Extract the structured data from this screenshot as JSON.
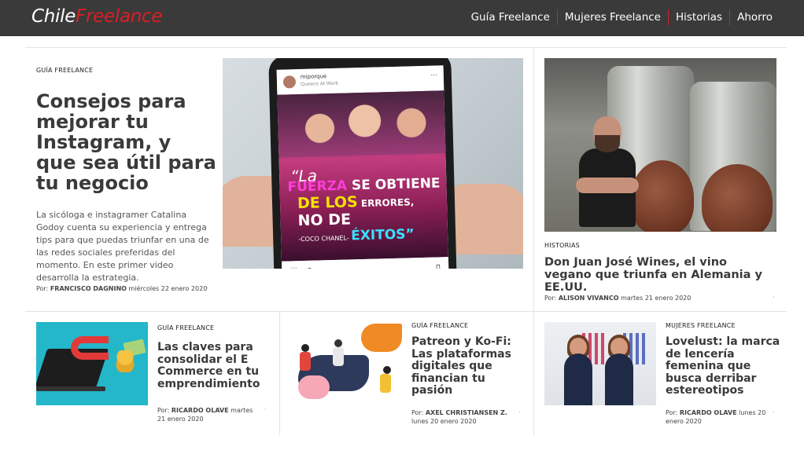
{
  "header": {
    "logo_part1": "Chile",
    "logo_part2": "Freelance",
    "nav": [
      "Guía Freelance",
      "Mujeres Freelance",
      "Historias",
      "Ahorro"
    ]
  },
  "featured": {
    "category": "GUÍA FREELANCE",
    "title": "Consejos para mejorar tu Instagram, y que sea útil para tu negocio",
    "description": "La sicóloga e instagramer Catalina Godoy cuenta su experiencia y entrega tips para que puedas triunfar en una de las redes sociales preferidas del momento. En este primer video desarrolla la estrategia.",
    "meta_prefix": "Por:",
    "author": "FRANCISCO DAGNINO",
    "date": "miércoles 22 enero 2020",
    "image": {
      "ig_user": "miporque",
      "ig_sub": "Queens At Work",
      "quote_mark": "“La",
      "quote_l1a": "FUERZA",
      "quote_l1b": " SE OBTIENE",
      "quote_l2a": "DE LOS",
      "quote_l2b": " ERRORES,",
      "quote_l3": "NO DE",
      "quote_l4a": "-COCO CHANEL- ",
      "quote_l4b": "ÉXITOS”"
    }
  },
  "side_article": {
    "category": "HISTORIAS",
    "title": "Don Juan José Wines, el vino vegano que triunfa en Alemania y EE.UU.",
    "meta_prefix": "Por:",
    "author": "ALISON VIVANCO",
    "date": "martes 21 enero 2020"
  },
  "cards": [
    {
      "category": "GUÍA FREELANCE",
      "title": "Las claves para consolidar el E Commerce en tu emprendimiento",
      "meta_prefix": "Por:",
      "author": "RICARDO OLAVE",
      "date": "martes 21 enero 2020"
    },
    {
      "category": "GUÍA FREELANCE",
      "title": "Patreon y Ko-Fi: Las plataformas digitales que financian tu pasión",
      "meta_prefix": "Por:",
      "author": "AXEL CHRISTIANSEN Z.",
      "date": "lunes 20 enero 2020"
    },
    {
      "category": "MUJERES FREELANCE",
      "title": "Lovelust: la marca de lencería femenina que busca derribar estereotipos",
      "meta_prefix": "Por:",
      "author": "RICARDO OLAVE",
      "date": "lunes 20 enero 2020"
    }
  ],
  "separator": "·",
  "colors": {
    "header_bg": "#3a3a3a",
    "accent": "#d81f26",
    "title": "#3a3a3a"
  }
}
